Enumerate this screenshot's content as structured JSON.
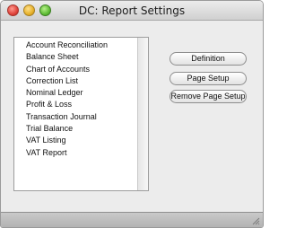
{
  "window": {
    "title": "DC: Report Settings"
  },
  "reports": {
    "items": [
      "Account Reconciliation",
      "Balance Sheet",
      "Chart of Accounts",
      "Correction List",
      "Nominal Ledger",
      "Profit & Loss",
      "Transaction Journal",
      "Trial Balance",
      "VAT Listing",
      "VAT Report"
    ]
  },
  "buttons": {
    "definition": "Definition",
    "page_setup": "Page Setup",
    "remove_page_setup": "Remove Page Setup"
  },
  "icons": {
    "close": "close-icon",
    "minimize": "minimize-icon",
    "zoom": "zoom-icon",
    "resize": "resize-grip-icon"
  },
  "colors": {
    "close": "#e0443c",
    "minimize": "#e6b12b",
    "zoom": "#5fbd35"
  }
}
